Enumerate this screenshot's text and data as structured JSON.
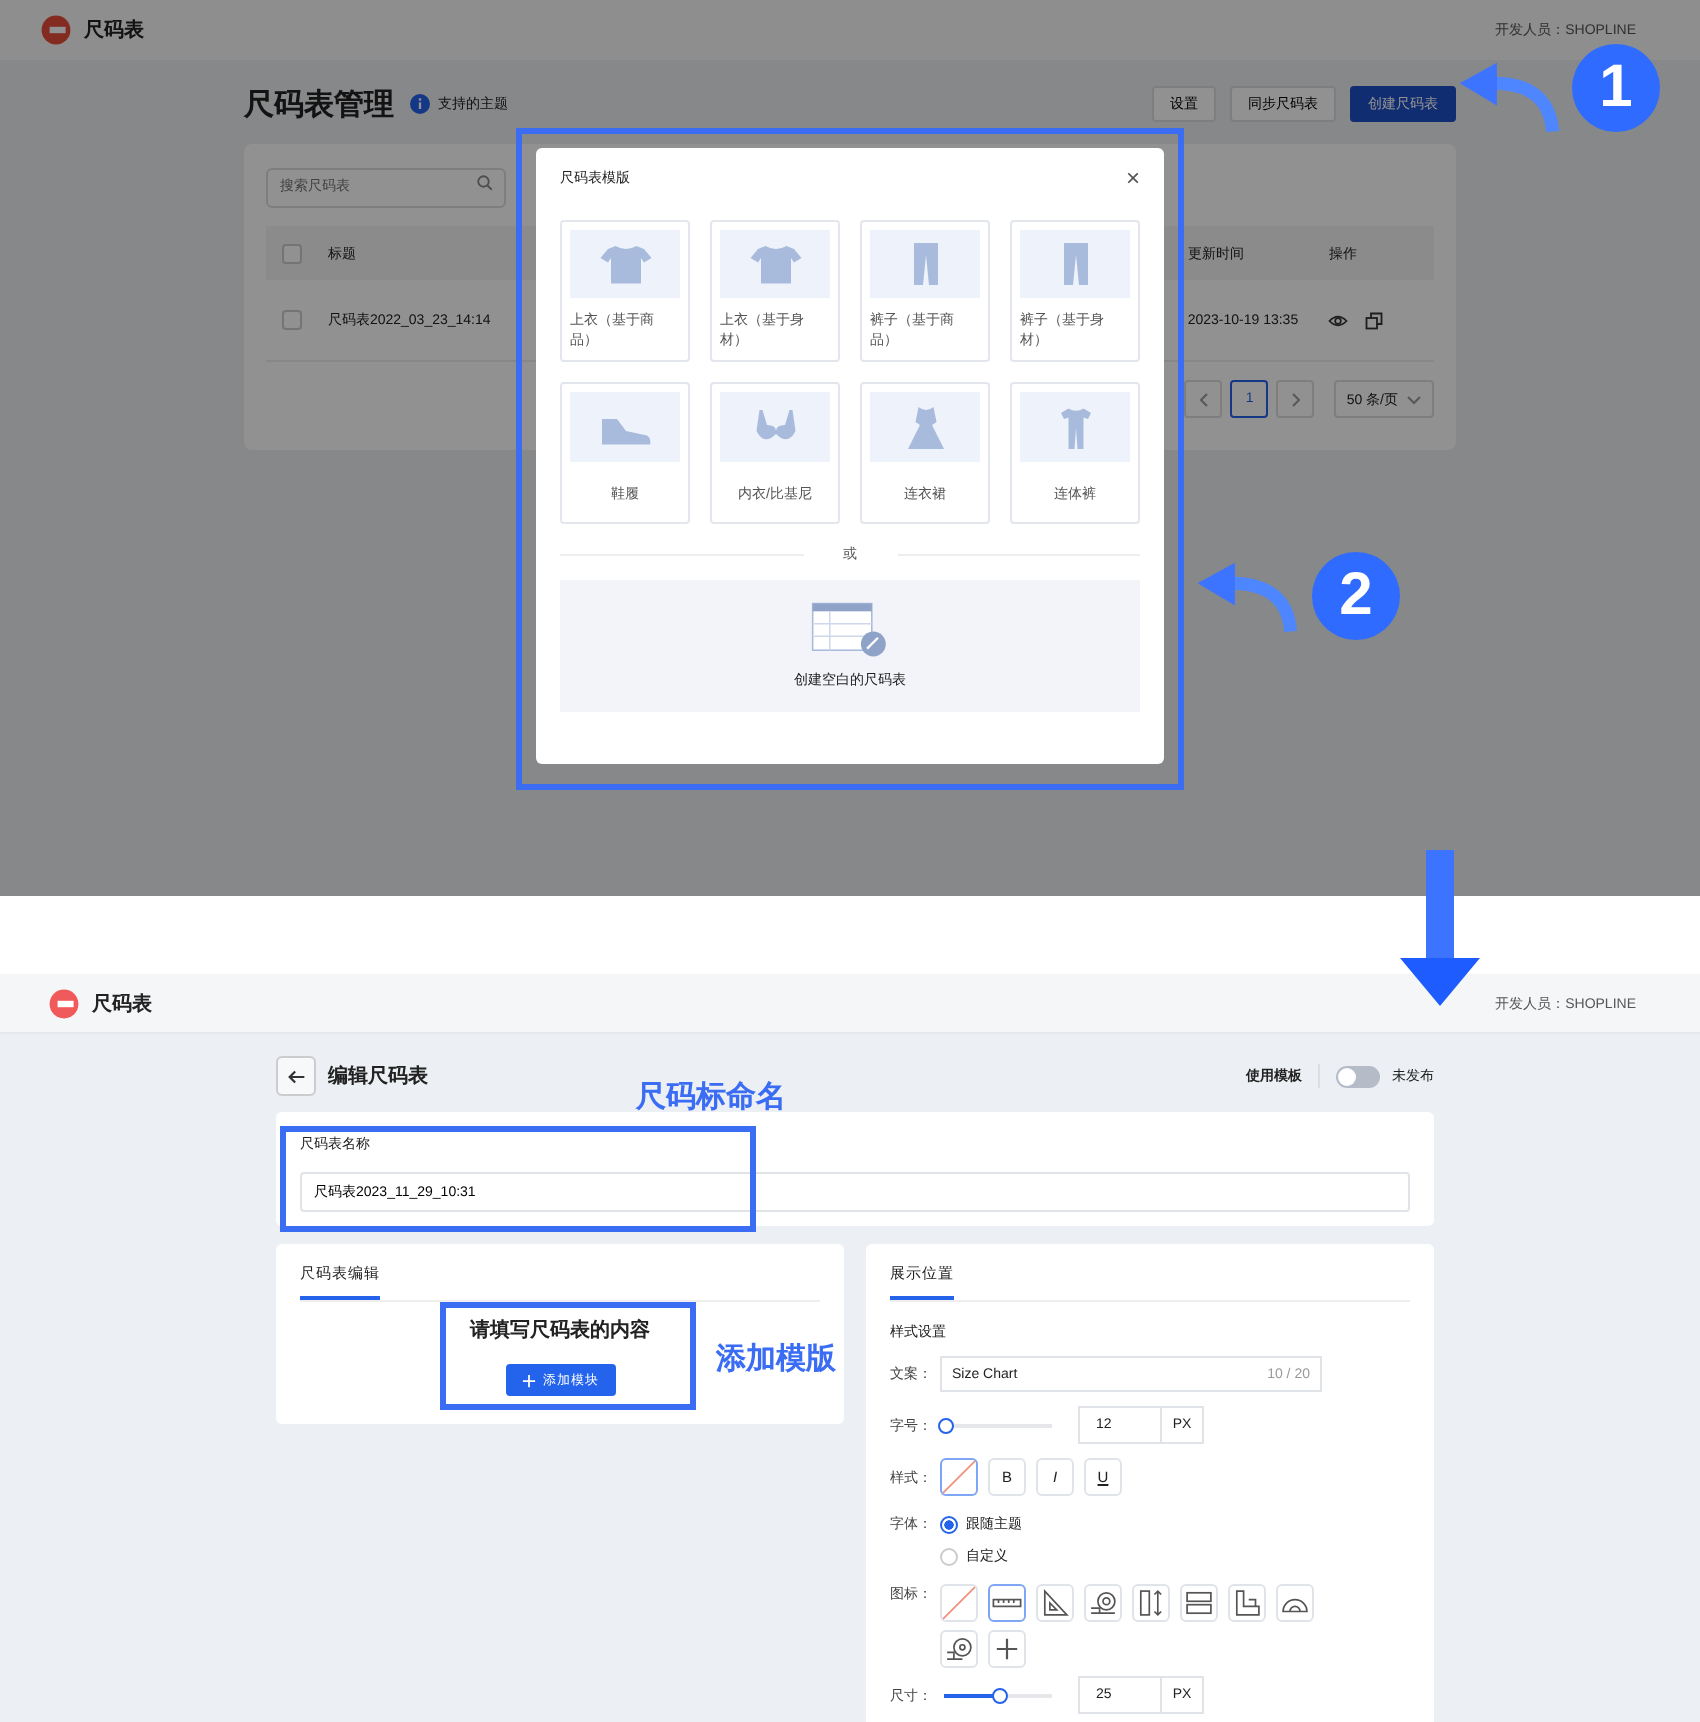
{
  "top_screen": {
    "header": {
      "app_name": "尺码表",
      "developer": "开发人员：SHOPLINE"
    },
    "title": "尺码表管理",
    "info_label": "支持的主题",
    "buttons": [
      {
        "label": "设置",
        "kind": "default"
      },
      {
        "label": "同步尺码表",
        "kind": "default"
      },
      {
        "label": "创建尺码表",
        "kind": "primary"
      }
    ],
    "search": {
      "placeholder": "搜索尺码表"
    },
    "table": {
      "all_checked": false,
      "columns": [
        "标题",
        "更新时间",
        "操作"
      ],
      "rows": [
        {
          "title": "尺码表2022_03_23_14:14",
          "updated": "2023-10-19 13:35",
          "checked": false
        }
      ]
    },
    "pagination": {
      "pages": [
        {
          "label": "1",
          "selected": true
        }
      ],
      "page_size": "50 条/页"
    },
    "modal": {
      "title": "尺码表模版",
      "close": "×",
      "templates": [
        {
          "label": "上衣（基于商品）",
          "kind": "shirt"
        },
        {
          "label": "上衣（基于身材）",
          "kind": "shirt"
        },
        {
          "label": "裤子（基于商品）",
          "kind": "pants"
        },
        {
          "label": "裤子（基于身材）",
          "kind": "pants"
        },
        {
          "label": "鞋履",
          "kind": "shoe"
        },
        {
          "label": "内衣/比基尼",
          "kind": "bra"
        },
        {
          "label": "连衣裙",
          "kind": "dress"
        },
        {
          "label": "连体裤",
          "kind": "jumpsuit"
        }
      ],
      "divider": "或",
      "blank_label": "创建空白的尺码表"
    }
  },
  "bottom_screen": {
    "header": {
      "app_name": "尺码表",
      "developer": "开发人员：SHOPLINE"
    },
    "title": "编辑尺码表",
    "use_template": "使用模板",
    "publish": {
      "on": false,
      "label": "未发布"
    },
    "name_card": {
      "label": "尺码表名称",
      "value": "尺码表2023_11_29_10:31"
    },
    "editor": {
      "tab": "尺码表编辑",
      "prompt": "请填写尺码表的内容",
      "add_button": "添加模块"
    },
    "settings": {
      "tab": "展示位置",
      "section": "样式设置",
      "text": {
        "label": "文案：",
        "value": "Size Chart",
        "counter": "10 / 20"
      },
      "font_size": {
        "label": "字号：",
        "level": 0,
        "value": "12",
        "unit": "PX"
      },
      "style": {
        "label": "样式：",
        "options": [
          {
            "kind": "none",
            "selected": true
          },
          {
            "kind": "bold",
            "label": "B",
            "selected": false
          },
          {
            "kind": "italic",
            "label": "I",
            "selected": false
          },
          {
            "kind": "underline",
            "label": "U",
            "selected": false
          }
        ]
      },
      "font": {
        "label": "字体：",
        "options": [
          {
            "label": "跟随主题",
            "selected": true
          },
          {
            "label": "自定义",
            "selected": false
          }
        ]
      },
      "icon": {
        "label": "图标：",
        "options": [
          {
            "kind": "none",
            "selected": false
          },
          {
            "kind": "ruler",
            "selected": true
          },
          {
            "kind": "triangle",
            "selected": false
          },
          {
            "kind": "tape",
            "selected": false
          },
          {
            "kind": "height",
            "selected": false
          },
          {
            "kind": "grid",
            "selected": false
          },
          {
            "kind": "square",
            "selected": false
          },
          {
            "kind": "protractor",
            "selected": false
          },
          {
            "kind": "tape_roll",
            "selected": false
          },
          {
            "kind": "add",
            "selected": false
          }
        ]
      },
      "size": {
        "label": "尺寸：",
        "level": 0.5,
        "value": "25",
        "unit": "PX"
      }
    }
  },
  "annotations": {
    "steps": [
      "1",
      "2"
    ],
    "name_note": "尺码标命名",
    "add_note": "添加模版"
  }
}
